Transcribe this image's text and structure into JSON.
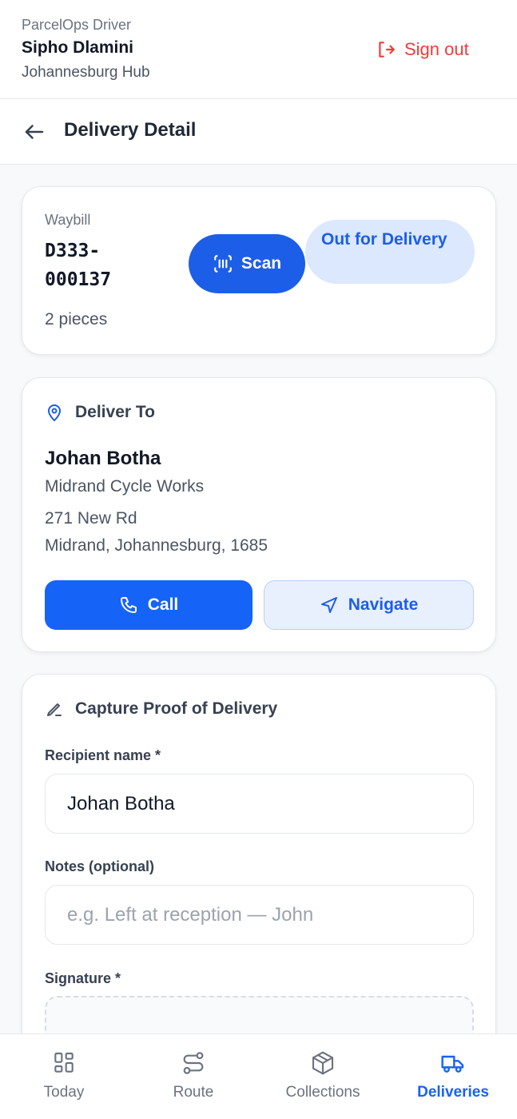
{
  "header": {
    "app_name": "ParcelOps Driver",
    "driver_name": "Sipho Dlamini",
    "hub": "Johannesburg Hub",
    "sign_out_label": "Sign out"
  },
  "page": {
    "title": "Delivery Detail"
  },
  "waybill": {
    "label": "Waybill",
    "number": "D333-000137",
    "pieces": "2 pieces",
    "scan_label": "Scan",
    "status": "Out for Delivery"
  },
  "deliver_to": {
    "heading": "Deliver To",
    "recipient": "Johan Botha",
    "company": "Midrand Cycle Works",
    "address_line1": "271 New Rd",
    "address_line2": "Midrand, Johannesburg, 1685",
    "call_label": "Call",
    "navigate_label": "Navigate"
  },
  "pod": {
    "heading": "Capture Proof of Delivery",
    "recipient_label": "Recipient name *",
    "recipient_value": "Johan Botha",
    "notes_label": "Notes (optional)",
    "notes_placeholder": "e.g. Left at reception — John",
    "notes_value": "",
    "signature_label": "Signature *"
  },
  "nav": {
    "items": [
      {
        "label": "Today",
        "icon": "grid-icon",
        "active": false
      },
      {
        "label": "Route",
        "icon": "route-icon",
        "active": false
      },
      {
        "label": "Collections",
        "icon": "box-icon",
        "active": false
      },
      {
        "label": "Deliveries",
        "icon": "truck-icon",
        "active": true
      }
    ]
  },
  "colors": {
    "accent": "#1663f7",
    "danger": "#ef3b3b",
    "badge_bg": "#dbe8fd"
  }
}
